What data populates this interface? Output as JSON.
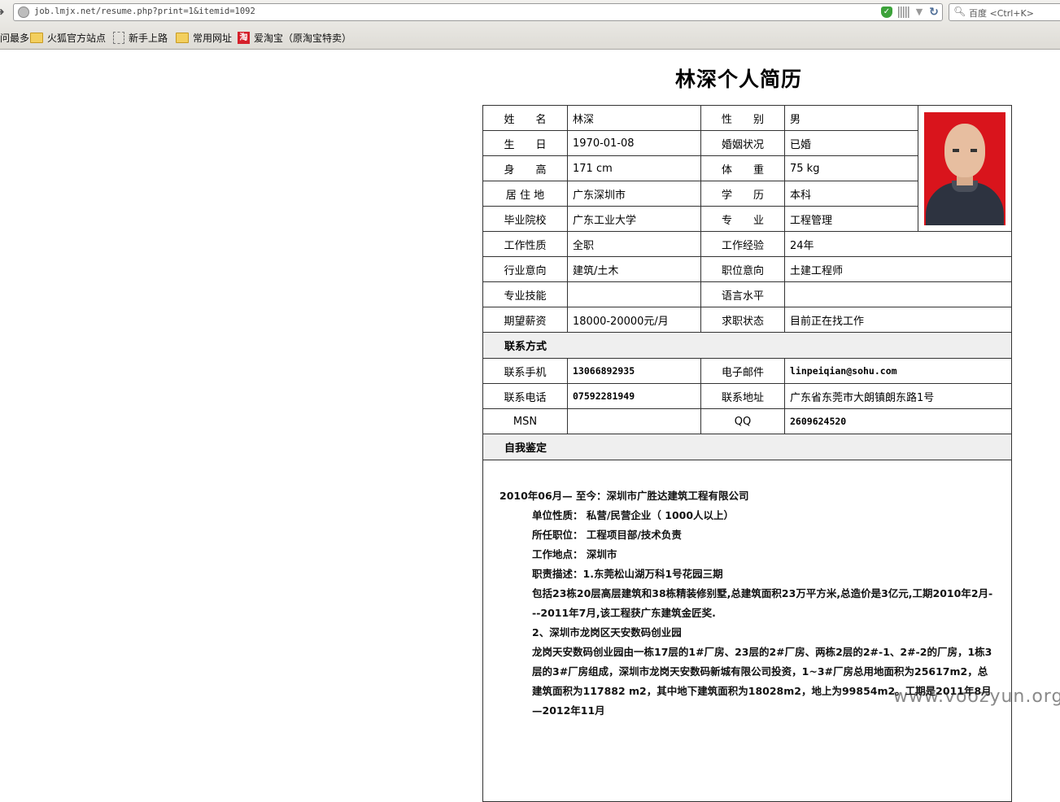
{
  "browser": {
    "url": "job.lmjx.net/resume.php?print=1&itemid=1092",
    "search_placeholder": "百度 <Ctrl+K>",
    "bookmarks": [
      "访问最多",
      "火狐官方站点",
      "新手上路",
      "常用网址",
      "爱淘宝（原淘宝特卖）"
    ],
    "tb_icon_glyph": "淘"
  },
  "resume": {
    "title": "林深个人简历",
    "rows": [
      {
        "l1": "姓　　名",
        "v1": "林深",
        "l2": "性　　别",
        "v2": "男"
      },
      {
        "l1": "生　　日",
        "v1": "1970-01-08",
        "l2": "婚姻状况",
        "v2": "已婚"
      },
      {
        "l1": "身　　高",
        "v1": "171 cm",
        "l2": "体　　重",
        "v2": "75 kg"
      },
      {
        "l1": "居 住 地",
        "v1": "广东深圳市",
        "l2": "学　　历",
        "v2": "本科"
      },
      {
        "l1": "毕业院校",
        "v1": "广东工业大学",
        "l2": "专　　业",
        "v2": "工程管理"
      },
      {
        "l1": "工作性质",
        "v1": "全职",
        "l2": "工作经验",
        "v2": "24年"
      },
      {
        "l1": "行业意向",
        "v1": "建筑/土木",
        "l2": "职位意向",
        "v2": "土建工程师"
      },
      {
        "l1": "专业技能",
        "v1": "",
        "l2": "语言水平",
        "v2": ""
      },
      {
        "l1": "期望薪资",
        "v1": "18000-20000元/月",
        "l2": "求职状态",
        "v2": "目前正在找工作"
      }
    ],
    "contact_section": "联系方式",
    "contact": [
      {
        "l1": "联系手机",
        "v1": "13066892935",
        "l2": "电子邮件",
        "v2": "linpeiqian@sohu.com"
      },
      {
        "l1": "联系电话",
        "v1": "07592281949",
        "l2": "联系地址",
        "v2": "广东省东莞市大朗镇朗东路1号"
      },
      {
        "l1": "MSN",
        "v1": "",
        "l2": "QQ",
        "v2": "2609624520"
      }
    ],
    "eval_section": "自我鉴定",
    "experience": {
      "company_line": "2010年06月— 至今：深圳市广胜达建筑工程有限公司",
      "nature": "单位性质： 私营/民营企业（ 1000人以上）",
      "position": "所任职位： 工程项目部/技术负责",
      "location": "工作地点： 深圳市",
      "desc_head": "职责描述：1.东莞松山湖万科1号花园三期",
      "desc_1": "包括23栋20层高层建筑和38栋精装修别墅,总建筑面积23万平方米,总造价是3亿元,工期2010年2月---2011年7月,该工程获广东建筑金匠奖.",
      "desc_2_head": "2、深圳市龙岗区天安数码创业园",
      "desc_2": "龙岗天安数码创业园由一栋17层的1#厂房、23层的2#厂房、两栋2层的2#-1、2#-2的厂房，1栋3层的3#厂房组成，深圳市龙岗天安数码新城有限公司投资，1~3#厂房总用地面积为25617m2，总建筑面积为117882 m2，其中地下建筑面积为18028m2，地上为99854m2。工期是2011年8月—2012年11月"
    }
  },
  "watermark": "www.voozyun.org",
  "colors": {
    "section_bg": "#efefef",
    "photo_bg": "#d9141c",
    "border": "#333333"
  }
}
